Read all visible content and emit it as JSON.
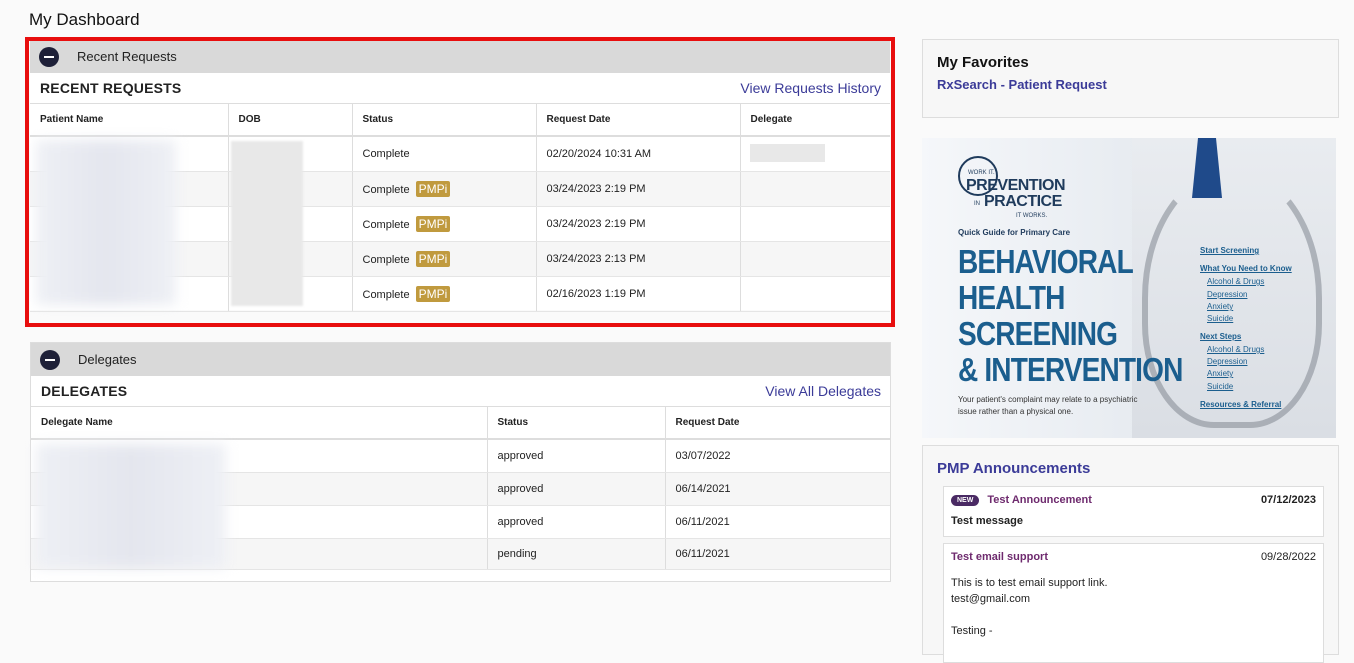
{
  "page": {
    "title": "My Dashboard"
  },
  "recent_requests": {
    "panel_label": "Recent Requests",
    "section_title": "RECENT REQUESTS",
    "history_link": "View Requests History",
    "columns": [
      "Patient Name",
      "DOB",
      "Status",
      "Request Date",
      "Delegate"
    ],
    "rows": [
      {
        "status": "Complete",
        "badge": "",
        "date": "02/20/2024 10:31 AM"
      },
      {
        "status": "Complete",
        "badge": "PMPi",
        "date": "03/24/2023 2:19 PM"
      },
      {
        "status": "Complete",
        "badge": "PMPi",
        "date": "03/24/2023 2:19 PM"
      },
      {
        "status": "Complete",
        "badge": "PMPi",
        "date": "03/24/2023 2:13 PM"
      },
      {
        "status": "Complete",
        "badge": "PMPi",
        "date": "02/16/2023 1:19 PM"
      }
    ]
  },
  "delegates": {
    "panel_label": "Delegates",
    "section_title": "DELEGATES",
    "all_link": "View All Delegates",
    "columns": [
      "Delegate Name",
      "Status",
      "Request Date"
    ],
    "rows": [
      {
        "status": "approved",
        "date": "03/07/2022"
      },
      {
        "status": "approved",
        "date": "06/14/2021"
      },
      {
        "status": "approved",
        "date": "06/11/2021"
      },
      {
        "status": "pending",
        "date": "06/11/2021"
      }
    ]
  },
  "favorites": {
    "title": "My Favorites",
    "link": "RxSearch - Patient Request"
  },
  "banner": {
    "logo_top": "WORK IT.",
    "logo_line1": "PREVENTION",
    "logo_in": "IN",
    "logo_line2": "PRACTICE",
    "logo_bottom": "IT WORKS.",
    "guide": "Quick Guide for Primary Care",
    "headline": [
      "BEHAVIORAL",
      "HEALTH",
      "SCREENING",
      "& INTERVENTION"
    ],
    "subtext": "Your patient's complaint may relate to a psychiatric issue rather than a physical one.",
    "nav": {
      "start": "Start Screening",
      "know": "What You Need to Know",
      "know_items": [
        "Alcohol & Drugs",
        "Depression",
        "Anxiety",
        "Suicide"
      ],
      "next": "Next Steps",
      "next_items": [
        "Alcohol & Drugs",
        "Depression",
        "Anxiety",
        "Suicide"
      ],
      "resources": "Resources & Referral"
    }
  },
  "announcements": {
    "title": "PMP Announcements",
    "items": [
      {
        "badge": "NEW",
        "title": "Test Announcement",
        "date": "07/12/2023",
        "body": [
          "Test message"
        ]
      },
      {
        "badge": "",
        "title": "Test email support",
        "date": "09/28/2022",
        "body": [
          "This is to test email support link.",
          "test@gmail.com",
          "",
          "Testing -"
        ]
      }
    ]
  }
}
